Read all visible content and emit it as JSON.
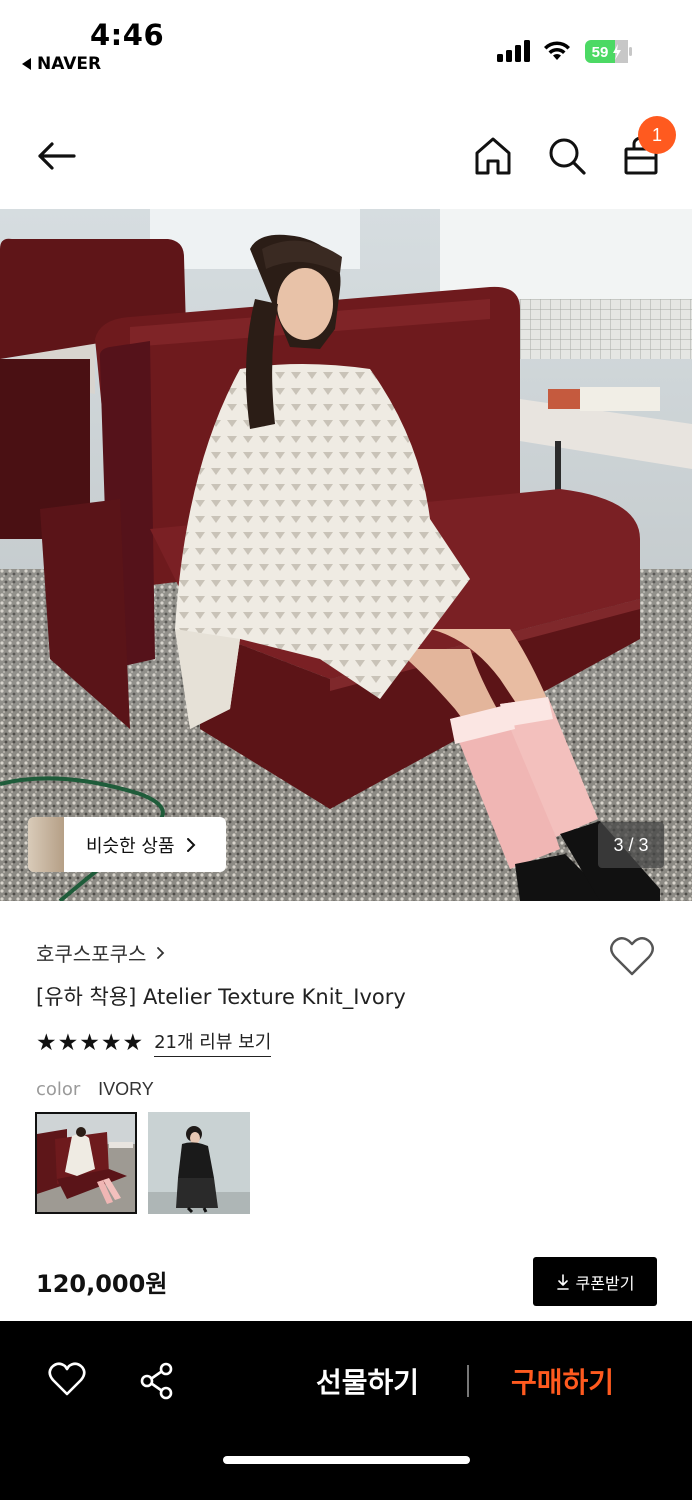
{
  "status": {
    "time": "4:46",
    "back_app": "NAVER",
    "battery": "59"
  },
  "header": {
    "cart_count": "1"
  },
  "hero": {
    "similar_label": "비슷한 상품",
    "counter": "3 / 3"
  },
  "product": {
    "brand": "호쿠스포쿠스",
    "title": "[유하 착용] Atelier Texture Knit_Ivory",
    "stars": "★★★★★",
    "review_link": "21개 리뷰 보기",
    "color_label": "color",
    "color_value": "IVORY",
    "price": "120,000원",
    "coupon_label": "쿠폰받기"
  },
  "bottom": {
    "gift_label": "선물하기",
    "buy_label": "구매하기"
  },
  "colors": {
    "accent": "#ff5a1f",
    "bar": "#000000",
    "sofa": "#6e1a1d"
  }
}
